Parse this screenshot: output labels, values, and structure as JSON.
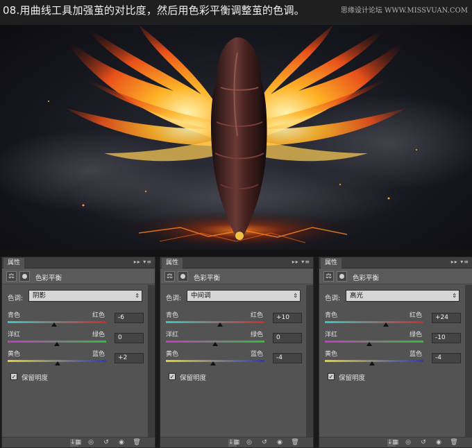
{
  "header": {
    "title": "08.用曲线工具加强茧的对比度，然后用色彩平衡调整茧的色调。",
    "watermark": "思缘设计论坛 WWW.MISSVUAN.COM"
  },
  "panels": [
    {
      "tab_label": "属性",
      "title": "色彩平衡",
      "tone_label": "色调:",
      "tone_value": "阴影",
      "sliders": [
        {
          "left": "青色",
          "right": "红色",
          "value": "-6",
          "level": -6
        },
        {
          "left": "洋红",
          "right": "绿色",
          "value": "0",
          "level": 0
        },
        {
          "left": "黄色",
          "right": "蓝色",
          "value": "+2",
          "level": 2
        }
      ],
      "preserve_label": "保留明度",
      "preserve_checked": true
    },
    {
      "tab_label": "属性",
      "title": "色彩平衡",
      "tone_label": "色调:",
      "tone_value": "中间调",
      "sliders": [
        {
          "left": "青色",
          "right": "红色",
          "value": "+10",
          "level": 10
        },
        {
          "left": "洋红",
          "right": "绿色",
          "value": "0",
          "level": 0
        },
        {
          "left": "黄色",
          "right": "蓝色",
          "value": "-4",
          "level": -4
        }
      ],
      "preserve_label": "保留明度",
      "preserve_checked": true
    },
    {
      "tab_label": "属性",
      "title": "色彩平衡",
      "tone_label": "色调:",
      "tone_value": "高光",
      "sliders": [
        {
          "left": "青色",
          "right": "红色",
          "value": "+24",
          "level": 24
        },
        {
          "left": "洋红",
          "right": "绿色",
          "value": "-10",
          "level": -10
        },
        {
          "left": "黄色",
          "right": "蓝色",
          "value": "-4",
          "level": -4
        }
      ],
      "preserve_label": "保留明度",
      "preserve_checked": true
    }
  ],
  "icons": {
    "tab_menu": "panel-menu-icon",
    "adjustment": "balance-icon",
    "mask": "mask-icon",
    "footer": [
      "clip-to-layer-icon",
      "view-previous-icon",
      "reset-icon",
      "visibility-icon",
      "trash-icon"
    ]
  },
  "colors": {
    "panel_bg": "#535353",
    "track_cyan_red": [
      "#35c8c4",
      "#d02b2b"
    ],
    "track_magenta_green": [
      "#c63ac3",
      "#2fbd3a"
    ],
    "track_yellow_blue": [
      "#e3d32a",
      "#2b39c9"
    ]
  }
}
